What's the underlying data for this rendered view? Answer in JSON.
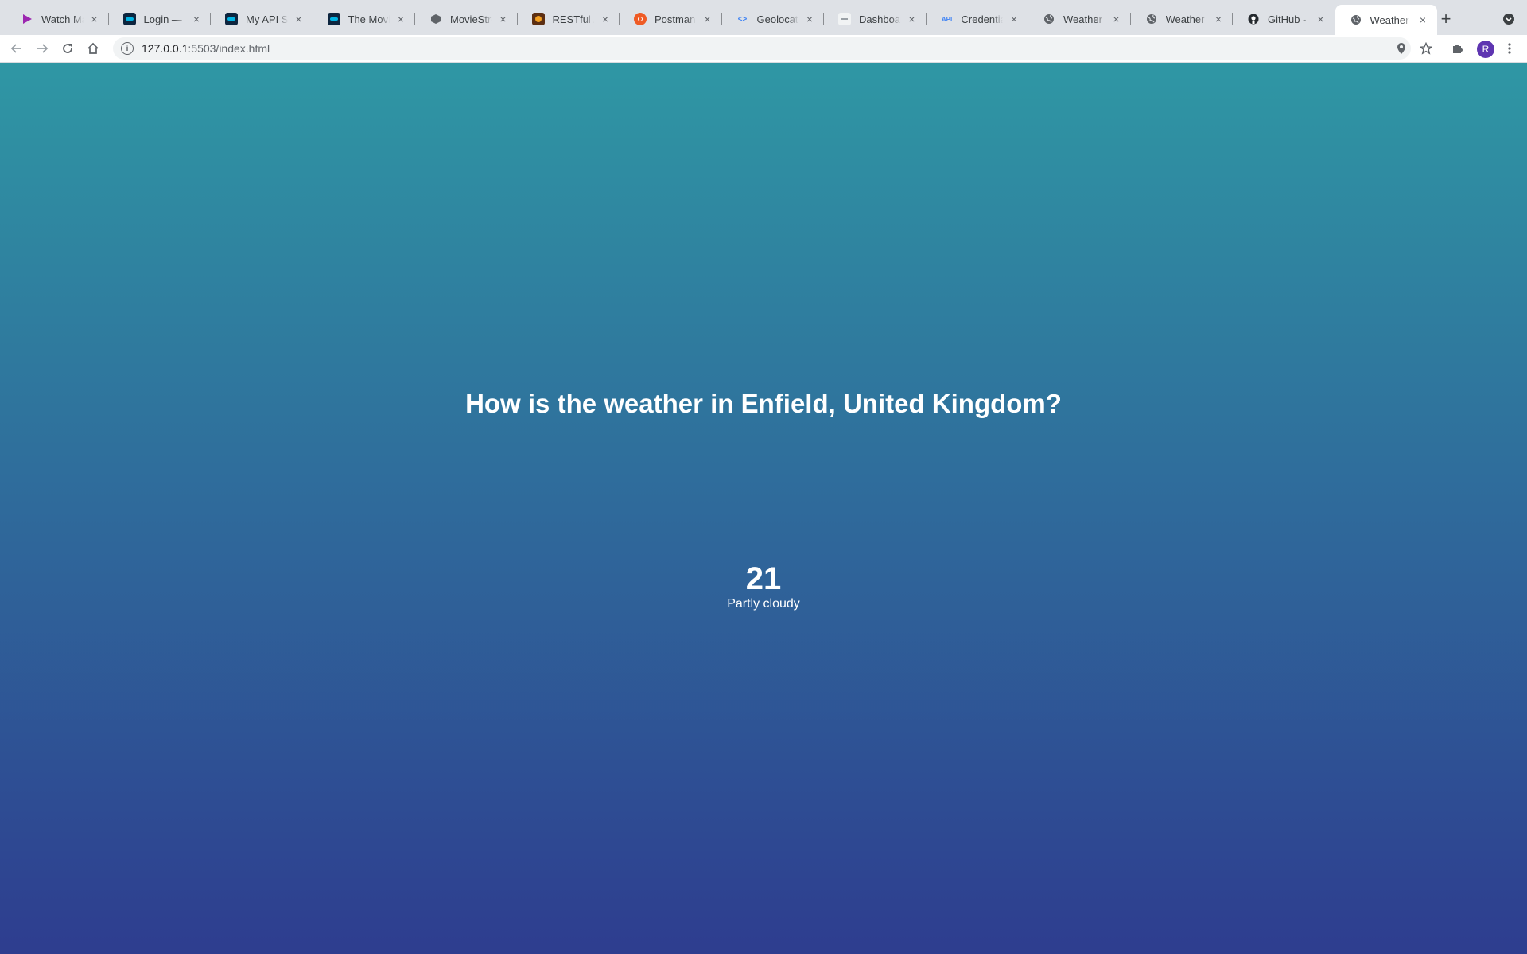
{
  "browser": {
    "tabs": [
      {
        "title": "Watch Magic",
        "icon": "play-icon"
      },
      {
        "title": "Login — The Movie Database",
        "icon": "tmdb-icon"
      },
      {
        "title": "My API Settings",
        "icon": "tmdb-icon"
      },
      {
        "title": "The Movie Database",
        "icon": "tmdb-icon"
      },
      {
        "title": "MovieStream",
        "icon": "cube-icon"
      },
      {
        "title": "RESTful API",
        "icon": "restful-icon"
      },
      {
        "title": "Postman",
        "icon": "postman-icon"
      },
      {
        "title": "Geolocation",
        "icon": "code-icon"
      },
      {
        "title": "Dashboard",
        "icon": "page-icon"
      },
      {
        "title": "Credentials",
        "icon": "api-icon"
      },
      {
        "title": "Weather",
        "icon": "globe-icon"
      },
      {
        "title": "Weather",
        "icon": "globe-icon"
      },
      {
        "title": "GitHub - m",
        "icon": "github-icon"
      },
      {
        "title": "Weather",
        "icon": "globe-icon",
        "active": true
      }
    ],
    "address": {
      "host": "127.0.0.1",
      "path": ":5503/index.html"
    },
    "profile_initial": "R"
  },
  "weather": {
    "heading": "How is the weather in Enfield, United Kingdom?",
    "temperature": "21",
    "description": "Partly cloudy"
  },
  "colors": {
    "gradient_top": "#2f97a4",
    "gradient_bottom": "#2e3d8f",
    "text": "#ffffff"
  }
}
